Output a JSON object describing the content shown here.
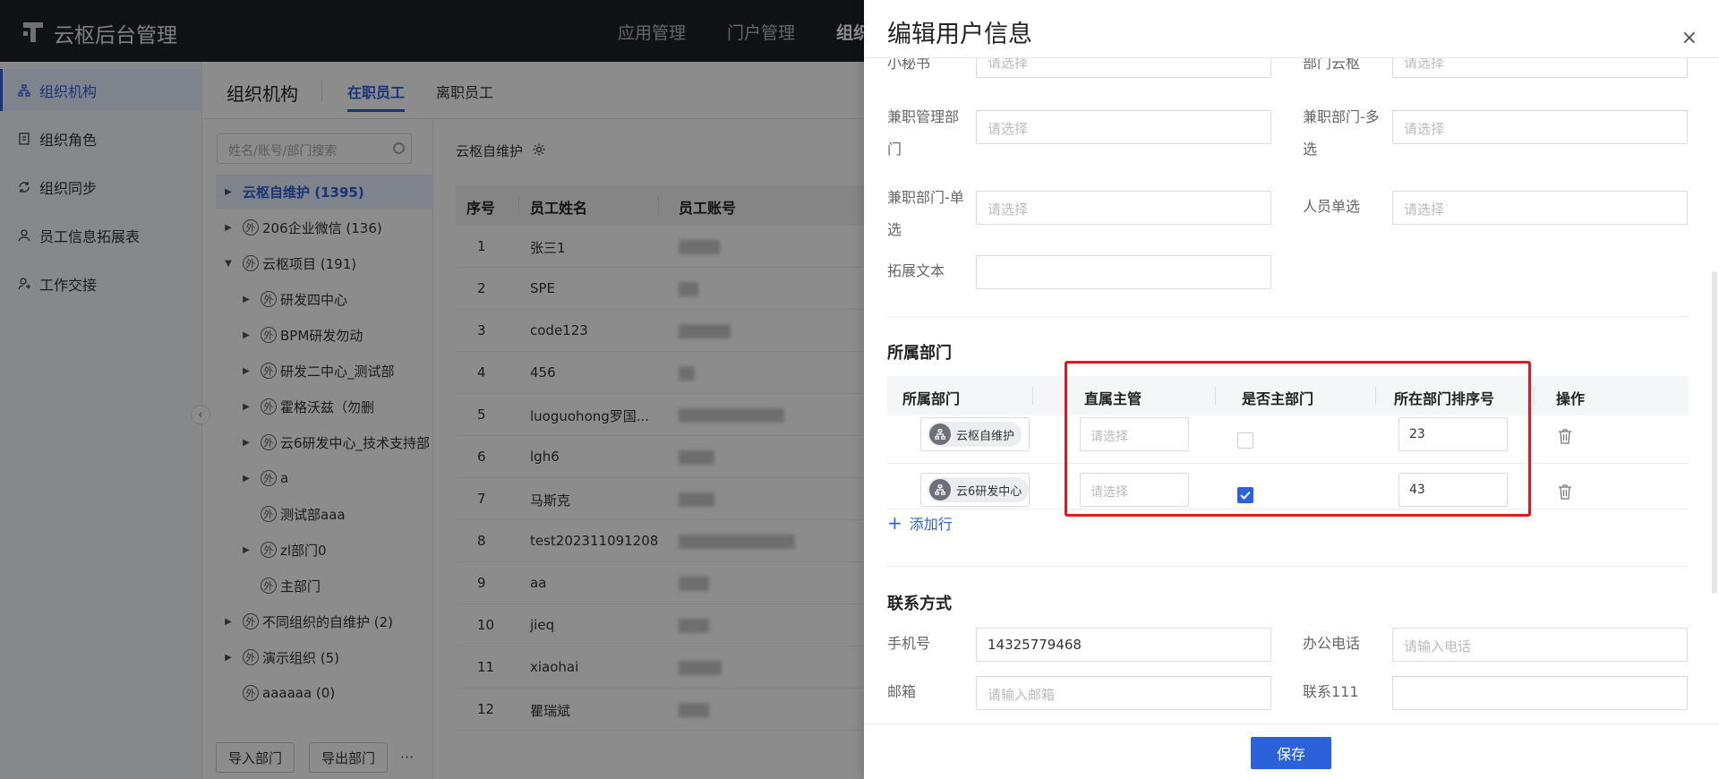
{
  "app": {
    "title": "云枢后台管理"
  },
  "topnav": [
    "应用管理",
    "门户管理",
    "组织"
  ],
  "sidebar": {
    "items": [
      {
        "label": "组织机构",
        "icon": "org-icon"
      },
      {
        "label": "组织角色",
        "icon": "role-icon"
      },
      {
        "label": "组织同步",
        "icon": "sync-icon"
      },
      {
        "label": "员工信息拓展表",
        "icon": "user-icon"
      },
      {
        "label": "工作交接",
        "icon": "handover-icon"
      }
    ]
  },
  "subheader": {
    "title": "组织机构",
    "tabs": [
      "在职员工",
      "离职员工"
    ]
  },
  "tree": {
    "search_placeholder": "姓名/账号/部门搜索",
    "nodes": [
      {
        "label": "云枢自维护 (1395)"
      },
      {
        "label": "206企业微信 (136)"
      },
      {
        "label": "云枢项目 (191)"
      },
      {
        "label": "研发四中心"
      },
      {
        "label": "BPM研发勿动"
      },
      {
        "label": "研发二中心_测试部"
      },
      {
        "label": "霍格沃兹（勿删"
      },
      {
        "label": "云6研发中心_技术支持部"
      },
      {
        "label": "a"
      },
      {
        "label": "测试部aaa"
      },
      {
        "label": "zl部门0"
      },
      {
        "label": "主部门"
      },
      {
        "label": "不同组织的自维护 (2)"
      },
      {
        "label": "演示组织 (5)"
      },
      {
        "label": "aaaaaa (0)"
      }
    ],
    "ext_icon_glyph": "外",
    "buttons": [
      "导入部门",
      "导出部门"
    ],
    "more": "···"
  },
  "main": {
    "breadcrumb": "云枢自维护",
    "columns": [
      "序号",
      "员工姓名",
      "员工账号"
    ],
    "rows": [
      {
        "no": "1",
        "name": "张三1"
      },
      {
        "no": "2",
        "name": "SPE"
      },
      {
        "no": "3",
        "name": "code123"
      },
      {
        "no": "4",
        "name": "456"
      },
      {
        "no": "5",
        "name": "luoguohong罗国..."
      },
      {
        "no": "6",
        "name": "lgh6"
      },
      {
        "no": "7",
        "name": "马斯克"
      },
      {
        "no": "8",
        "name": "test202311091208"
      },
      {
        "no": "9",
        "name": "aa"
      },
      {
        "no": "10",
        "name": "jieq"
      },
      {
        "no": "11",
        "name": "xiaohai"
      },
      {
        "no": "12",
        "name": "瞿瑞斌"
      }
    ]
  },
  "drawer": {
    "title": "编辑用户信息",
    "close": "×",
    "fields": {
      "secretary": {
        "label": "小秘书",
        "placeholder": "请选择"
      },
      "dept_yunshu": {
        "label": "部门云枢",
        "placeholder": "请选择"
      },
      "parttime_mgmt_dept": {
        "label": "兼职管理部门",
        "placeholder": "请选择"
      },
      "parttime_dept_multi": {
        "label": "兼职部门-多选",
        "placeholder": "请选择"
      },
      "parttime_dept_single": {
        "label": "兼职部门-单选",
        "placeholder": "请选择"
      },
      "person_single": {
        "label": "人员单选",
        "placeholder": "请选择"
      },
      "ext_text": {
        "label": "拓展文本",
        "value": ""
      }
    },
    "dept_section": {
      "title": "所属部门",
      "columns": [
        "所属部门",
        "直属主管",
        "是否主部门",
        "所在部门排序号",
        "操作"
      ],
      "rows": [
        {
          "dept": "云枢自维护",
          "manager_placeholder": "请选择",
          "is_main": false,
          "order": "23"
        },
        {
          "dept": "云6研发中心",
          "manager_placeholder": "请选择",
          "is_main": true,
          "order": "43"
        }
      ],
      "add_row": "添加行"
    },
    "contact_section": {
      "title": "联系方式",
      "phone": {
        "label": "手机号",
        "value": "14325779468"
      },
      "office_phone": {
        "label": "办公电话",
        "placeholder": "请输入电话"
      },
      "email": {
        "label": "邮箱",
        "placeholder": "请输入邮箱"
      },
      "contact111": {
        "label": "联系111",
        "value": ""
      }
    },
    "save": "保存"
  },
  "colors": {
    "accent": "#2b62d9",
    "highlight": "#e8161c",
    "topbar": "#1e2229"
  }
}
